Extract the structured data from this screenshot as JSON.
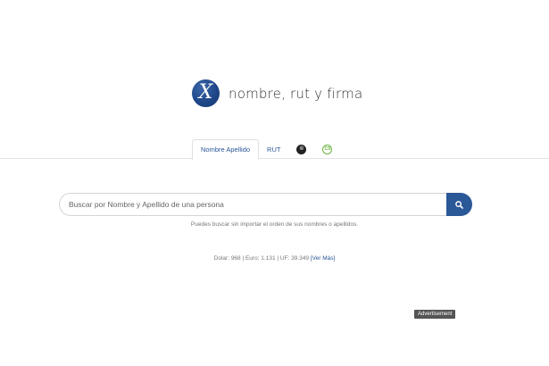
{
  "logo": {
    "mark": "X",
    "text": "nombre, rut y firma"
  },
  "tabs": [
    {
      "label": "Nombre Apellido",
      "active": true
    },
    {
      "label": "RUT",
      "active": false
    }
  ],
  "tab_icons": [
    {
      "icon": "cc-icon",
      "glyph": "©"
    },
    {
      "icon": "cs-icon",
      "glyph": "CS"
    }
  ],
  "search": {
    "placeholder": "Buscar por Nombre y Apellido de una persona",
    "value": "",
    "button_icon": "search-icon"
  },
  "hint": "Puedes buscar sin importar el orden de sus nombres o apellidos.",
  "rates": {
    "text": "Dolar: 968 | Euro: 1.131 | UF: 39.349",
    "link": "[Ver Más]"
  },
  "ad_label": "Advertisement",
  "colors": {
    "brand": "#2b5896",
    "link": "#2a5597",
    "cs_green": "#6cb33f"
  }
}
